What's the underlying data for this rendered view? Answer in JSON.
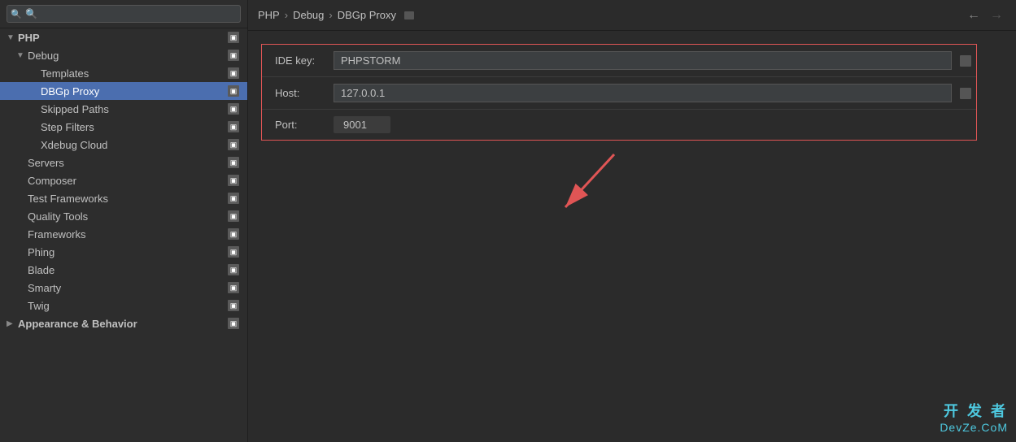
{
  "sidebar": {
    "search": {
      "placeholder": "🔍",
      "value": ""
    },
    "items": [
      {
        "id": "php",
        "label": "PHP",
        "level": 0,
        "expanded": true,
        "hasArrow": true,
        "bold": true
      },
      {
        "id": "debug",
        "label": "Debug",
        "level": 1,
        "expanded": true,
        "hasArrow": true,
        "bold": false
      },
      {
        "id": "templates",
        "label": "Templates",
        "level": 2,
        "expanded": false,
        "hasArrow": false,
        "bold": false
      },
      {
        "id": "dbgp-proxy",
        "label": "DBGp Proxy",
        "level": 2,
        "expanded": false,
        "hasArrow": false,
        "bold": false,
        "active": true
      },
      {
        "id": "skipped-paths",
        "label": "Skipped Paths",
        "level": 2,
        "expanded": false,
        "hasArrow": false,
        "bold": false
      },
      {
        "id": "step-filters",
        "label": "Step Filters",
        "level": 2,
        "expanded": false,
        "hasArrow": false,
        "bold": false
      },
      {
        "id": "xdebug-cloud",
        "label": "Xdebug Cloud",
        "level": 2,
        "expanded": false,
        "hasArrow": false,
        "bold": false
      },
      {
        "id": "servers",
        "label": "Servers",
        "level": 1,
        "expanded": false,
        "hasArrow": false,
        "bold": false
      },
      {
        "id": "composer",
        "label": "Composer",
        "level": 1,
        "expanded": false,
        "hasArrow": false,
        "bold": false
      },
      {
        "id": "test-frameworks",
        "label": "Test Frameworks",
        "level": 1,
        "expanded": false,
        "hasArrow": false,
        "bold": false
      },
      {
        "id": "quality-tools",
        "label": "Quality Tools",
        "level": 1,
        "expanded": false,
        "hasArrow": false,
        "bold": false
      },
      {
        "id": "frameworks",
        "label": "Frameworks",
        "level": 1,
        "expanded": false,
        "hasArrow": false,
        "bold": false
      },
      {
        "id": "phing",
        "label": "Phing",
        "level": 1,
        "expanded": false,
        "hasArrow": false,
        "bold": false
      },
      {
        "id": "blade",
        "label": "Blade",
        "level": 1,
        "expanded": false,
        "hasArrow": false,
        "bold": false
      },
      {
        "id": "smarty",
        "label": "Smarty",
        "level": 1,
        "expanded": false,
        "hasArrow": false,
        "bold": false
      },
      {
        "id": "twig",
        "label": "Twig",
        "level": 1,
        "expanded": false,
        "hasArrow": false,
        "bold": false
      },
      {
        "id": "appearance-behavior",
        "label": "Appearance & Behavior",
        "level": 0,
        "expanded": false,
        "hasArrow": true,
        "bold": true
      }
    ]
  },
  "breadcrumb": {
    "items": [
      "PHP",
      "Debug",
      "DBGp Proxy"
    ],
    "separator": "›"
  },
  "form": {
    "title": "DBGp Proxy",
    "fields": [
      {
        "id": "ide-key",
        "label": "IDE key:",
        "value": "PHPSTORM"
      },
      {
        "id": "host",
        "label": "Host:",
        "value": "127.0.0.1"
      },
      {
        "id": "port",
        "label": "Port:",
        "value": "9001"
      }
    ]
  },
  "watermark": {
    "line1": "开 发 者",
    "line2": "DevZe.CoM"
  }
}
